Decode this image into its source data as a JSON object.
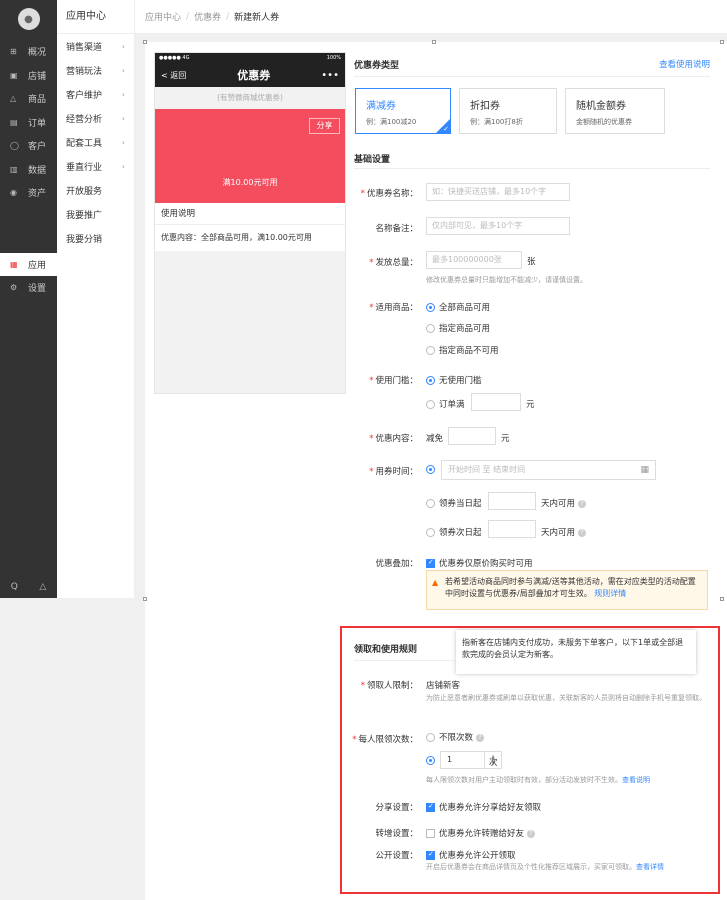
{
  "sidebar": {
    "logo": "●",
    "items": [
      {
        "icon": "⊞",
        "label": "概况"
      },
      {
        "icon": "▣",
        "label": "店铺"
      },
      {
        "icon": "△",
        "label": "商品"
      },
      {
        "icon": "▤",
        "label": "订单"
      },
      {
        "icon": "◯",
        "label": "客户"
      },
      {
        "icon": "▥",
        "label": "数据"
      },
      {
        "icon": "◉",
        "label": "资产"
      },
      {
        "icon": "▦",
        "label": "应用"
      },
      {
        "icon": "⚙",
        "label": "设置"
      }
    ],
    "bottom_icons": [
      "Q",
      "△"
    ]
  },
  "subnav": {
    "title": "应用中心",
    "items": [
      {
        "label": "销售渠道",
        "chev": "›"
      },
      {
        "label": "营销玩法",
        "chev": "›"
      },
      {
        "label": "客户维护",
        "chev": "›"
      },
      {
        "label": "经营分析",
        "chev": "›"
      },
      {
        "label": "配套工具",
        "chev": "›"
      },
      {
        "label": "垂直行业",
        "chev": "›"
      },
      {
        "label": "开放服务",
        "chev": ""
      },
      {
        "label": "我要推广",
        "chev": ""
      },
      {
        "label": "我要分销",
        "chev": ""
      }
    ]
  },
  "breadcrumb": [
    "应用中心",
    "优惠券",
    "新建新人券"
  ],
  "phone": {
    "status_left": "●●●●● 4G",
    "status_right": "100%",
    "back": "< 返回",
    "title": "优惠券",
    "more": "•••",
    "shop": "(有赞微商城优惠券)",
    "share": "分享",
    "amount": "满10.00元可用",
    "desc_title": "使用说明",
    "desc": "优惠内容：全部商品可用，满10.00元可用"
  },
  "type_section": {
    "title": "优惠券类型",
    "help_link": "查看使用说明",
    "cards": [
      {
        "title": "满减券",
        "sub": "例：满100减20"
      },
      {
        "title": "折扣券",
        "sub": "例：满100打8折"
      },
      {
        "title": "随机金额券",
        "sub": "金额随机的优惠券"
      }
    ]
  },
  "basic": {
    "title": "基础设置",
    "name_label": "优惠券名称：",
    "name_ph": "如：快捷买送店铺，最多10个字",
    "remark_label": "名称备注：",
    "remark_ph": "仅内部可见，最多10个字",
    "qty_label": "发放总量：",
    "qty_ph": "最多100000000张",
    "qty_unit": "张",
    "qty_help": "修改优惠券总量时只能增加不能减少，请谨慎设置。",
    "goods_label": "适用商品：",
    "goods_opts": [
      "全部商品可用",
      "指定商品可用",
      "指定商品不可用"
    ],
    "threshold_label": "使用门槛：",
    "threshold_opts": [
      "无使用门槛",
      "订单满"
    ],
    "threshold_unit": "元",
    "content_label": "优惠内容：",
    "content_prefix": "减免",
    "content_unit": "元",
    "time_label": "用券时间：",
    "time_ph": "开始时间  至  结束时间",
    "time_opt2": "领券当日起",
    "time_opt3": "领券次日起",
    "time_suffix": "天内可用",
    "stack_label": "优惠叠加：",
    "stack_opt": "优惠券仅原价购买时可用",
    "warn_text": "若希望活动商品同时参与满减/送等其他活动，需在对应类型的活动配置中同时设置与优惠券/局部叠加才可生效。",
    "warn_link": "规则详情"
  },
  "rules": {
    "title": "领取和使用规则",
    "tooltip": "指新客在店铺内支付成功，未服务下单客户，以下1单或全部退款完成的会员认定为新客。",
    "who_label": "领取人限制：",
    "who_value": "店铺新客",
    "who_help": "为防止恶意者刷优惠券或刷单以获取优惠，关联新客的人员则将自动删除手机号重复领取。",
    "times_label": "每人限领次数：",
    "times_opt1": "不限次数",
    "times_value": "1",
    "times_unit": "次",
    "times_help": "每人限领次数对用户主动领取时有效，部分活动发放时不生效。",
    "times_link": "查看说明",
    "share_label": "分享设置：",
    "share_opt": "优惠券允许分享给好友领取",
    "transfer_label": "转增设置：",
    "transfer_opt": "优惠券允许转赠给好友",
    "public_label": "公开设置：",
    "public_opt": "优惠券允许公开领取",
    "public_help": "开启后优惠券会在商品详情页及个性化推荐区域展示，买家可领取。",
    "public_link": "查看详情"
  }
}
